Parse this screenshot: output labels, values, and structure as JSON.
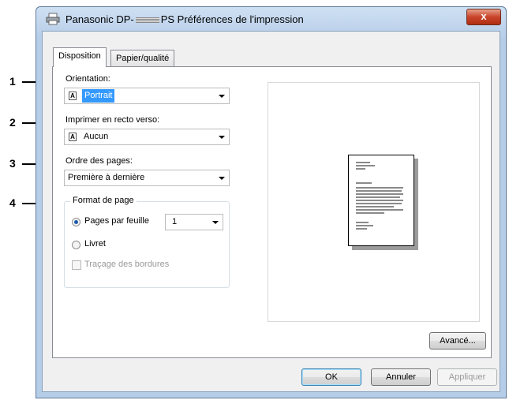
{
  "window": {
    "title_prefix": "Panasonic DP-",
    "title_suffix": "PS Préférences de l'impression",
    "close_glyph": "x"
  },
  "tabs": [
    {
      "label": "Disposition",
      "active": true
    },
    {
      "label": "Papier/qualité",
      "active": false
    }
  ],
  "callouts": [
    "1",
    "2",
    "3",
    "4"
  ],
  "orientation": {
    "label": "Orientation:",
    "value": "Portrait",
    "icon_letter": "A"
  },
  "duplex": {
    "label": "Imprimer en recto verso:",
    "value": "Aucun",
    "icon_letter": "A"
  },
  "page_order": {
    "label": "Ordre des pages:",
    "value": "Première à dernière"
  },
  "page_format": {
    "title": "Format de page",
    "pages_per_sheet_label": "Pages par feuille",
    "pages_per_sheet_value": "1",
    "booklet_label": "Livret",
    "borders_label": "Traçage des bordures",
    "selected": "pages_per_sheet",
    "borders_checked": false
  },
  "buttons": {
    "advanced": "Avancé...",
    "ok": "OK",
    "cancel": "Annuler",
    "apply": "Appliquer"
  },
  "colors": {
    "selection": "#3399ff",
    "close_button": "#c8452b"
  }
}
